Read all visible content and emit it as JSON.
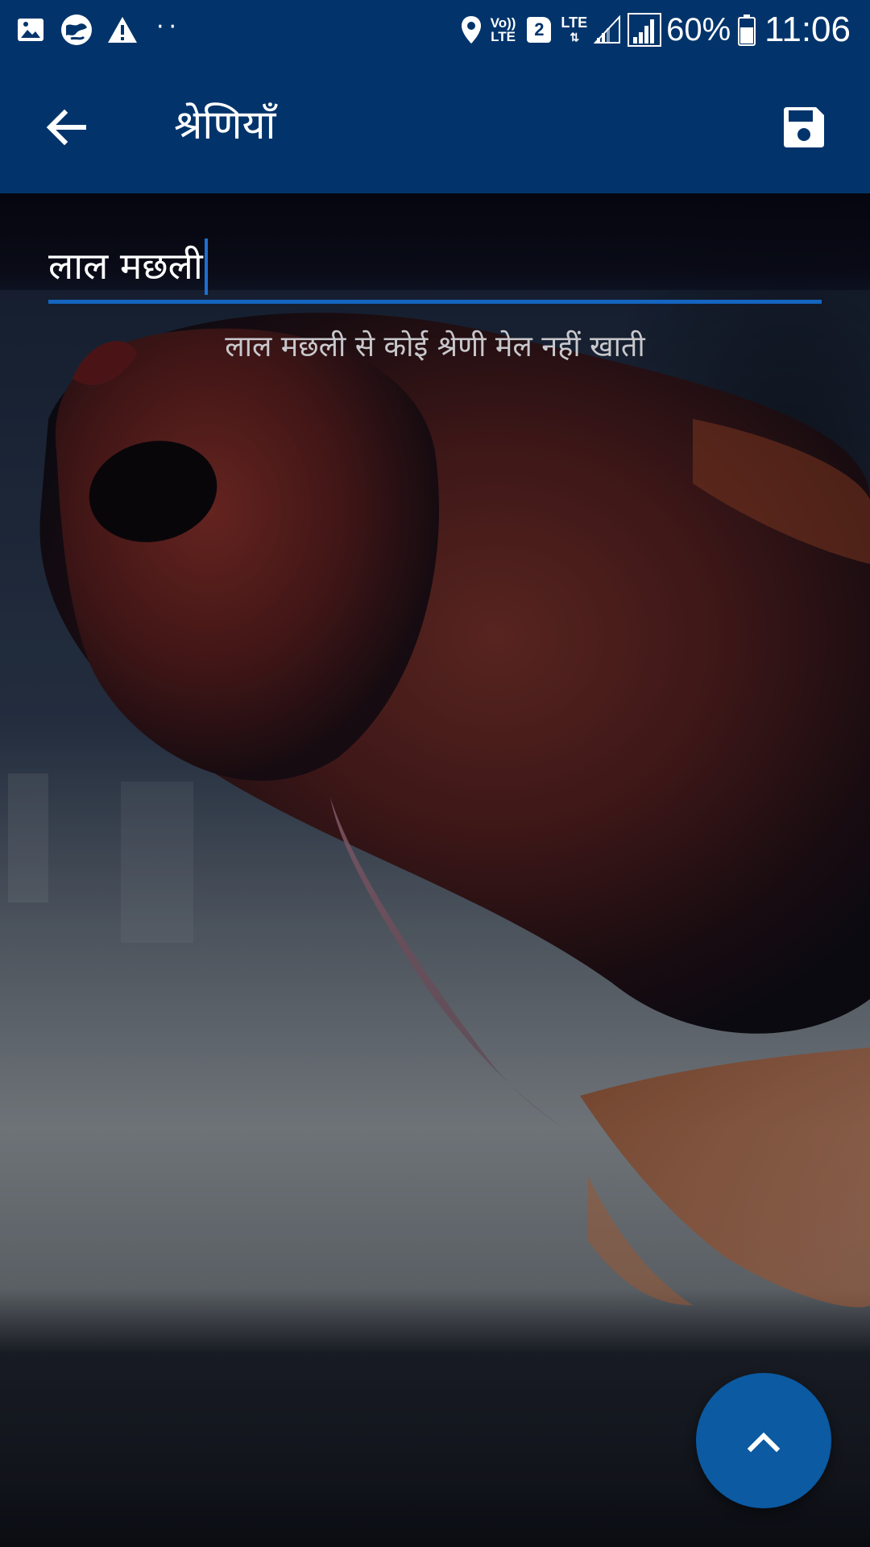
{
  "status_bar": {
    "left_icons": [
      "gallery-icon",
      "globe-icon",
      "warning-icon"
    ],
    "dots": "··",
    "volte_top": "Vo))",
    "volte_bottom": "LTE",
    "sim_slot": "2",
    "network_type": "LTE",
    "battery_percent": "60%",
    "time": "11:06"
  },
  "app_bar": {
    "title": "श्रेणियाँ",
    "back_icon": "arrow-left-icon",
    "save_icon": "save-icon",
    "background_color": "#02346b"
  },
  "search": {
    "value": "लाल मछली",
    "underline_color": "#1565c0"
  },
  "results": {
    "empty_message": "लाल मछली से कोई श्रेणी मेल नहीं खाती"
  },
  "fab": {
    "icon": "chevron-up-icon",
    "color": "#0b5aa2"
  }
}
